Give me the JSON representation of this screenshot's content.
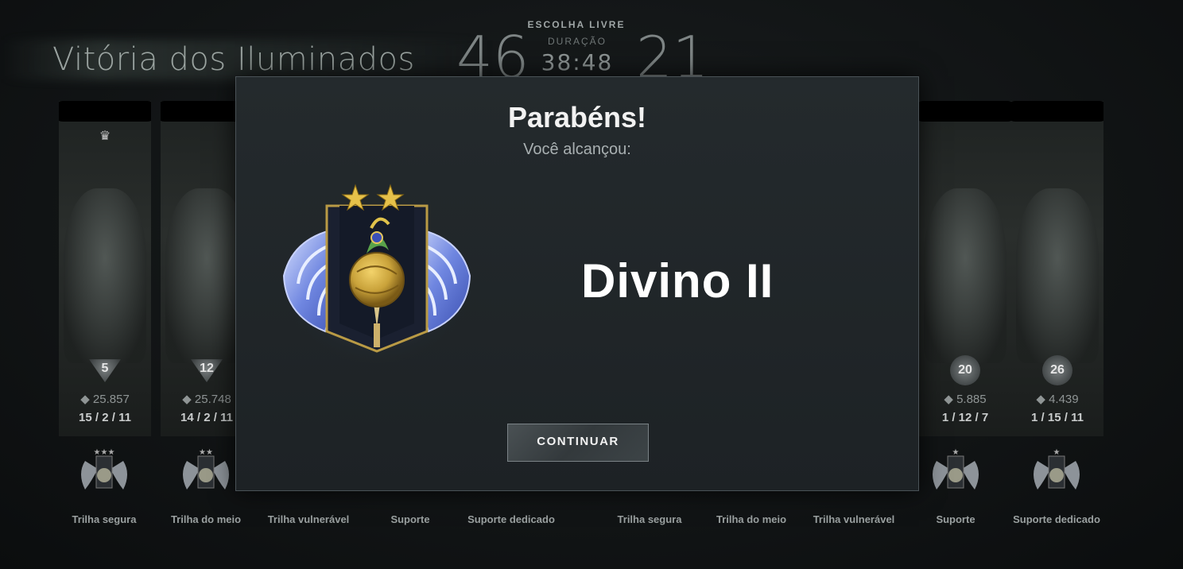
{
  "header": {
    "victory_text": "Vitória dos Iluminados",
    "game_mode": "ESCOLHA LIVRE",
    "duration_label": "DURAÇÃO",
    "duration_value": "38:48",
    "score_left": "46",
    "score_right": "21"
  },
  "players": [
    {
      "level": "5",
      "gold": "25.857",
      "kda": "15 / 2 / 11",
      "role": "Trilha segura"
    },
    {
      "level": "12",
      "gold": "25.748",
      "kda": "14 / 2 / 11",
      "role": "Trilha do meio"
    },
    {
      "level": "",
      "gold": "",
      "kda": "",
      "role": "Trilha vulnerável"
    },
    {
      "level": "",
      "gold": "",
      "kda": "",
      "role": "Suporte"
    },
    {
      "level": "",
      "gold": "",
      "kda": "",
      "role": "Suporte dedicado"
    },
    {
      "level": "",
      "gold": "",
      "kda": "",
      "role": "Trilha segura"
    },
    {
      "level": "",
      "gold": "",
      "kda": "",
      "role": "Trilha do meio"
    },
    {
      "level": "",
      "gold": "",
      "kda": "",
      "role": "Trilha vulnerável"
    },
    {
      "level": "20",
      "gold": "5.885",
      "kda": "1 / 12 / 7",
      "role": "Suporte"
    },
    {
      "level": "26",
      "gold": "4.439",
      "kda": "1 / 15 / 11",
      "role": "Suporte dedicado"
    }
  ],
  "modal": {
    "title": "Parabéns!",
    "subtitle": "Você alcançou:",
    "rank_name": "Divino II",
    "continue_label": "CONTINUAR"
  },
  "icons": {
    "gold": "gold-icon",
    "crown": "crown-icon",
    "medal": "divine-medal-icon"
  },
  "colors": {
    "medal_wings": "#6f86e0",
    "medal_gold": "#c9a23a"
  }
}
